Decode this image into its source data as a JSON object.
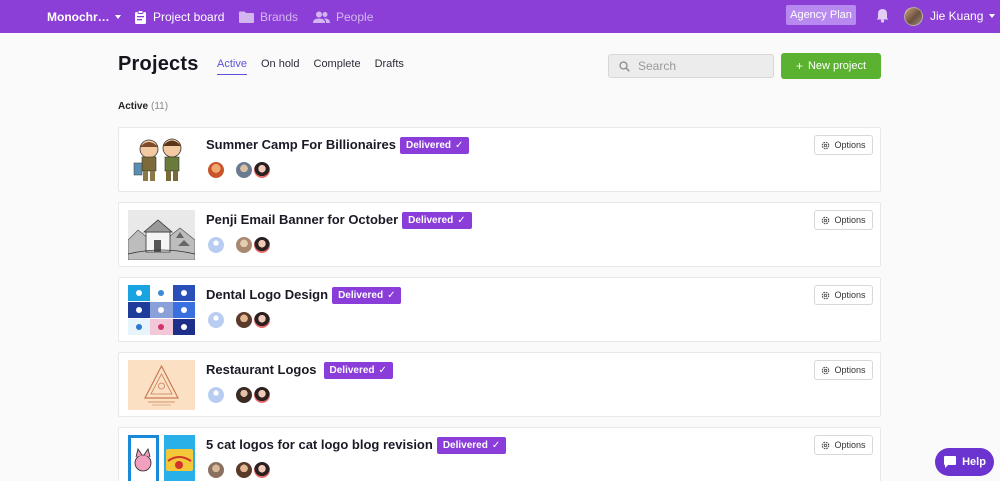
{
  "nav": {
    "brand": "Monochr…",
    "links": [
      {
        "label": "Project board",
        "icon": "clipboard-icon",
        "active": true
      },
      {
        "label": "Brands",
        "icon": "folder-icon",
        "active": false
      },
      {
        "label": "People",
        "icon": "people-icon",
        "active": false
      }
    ],
    "plan_badge": "Agency Plan",
    "user_name": "Jie Kuang"
  },
  "header": {
    "title": "Projects",
    "tabs": [
      {
        "label": "Active",
        "active": true
      },
      {
        "label": "On hold",
        "active": false
      },
      {
        "label": "Complete",
        "active": false
      },
      {
        "label": "Drafts",
        "active": false
      }
    ],
    "search_placeholder": "Search",
    "new_project_label": "New project"
  },
  "section": {
    "label": "Active",
    "count": "(11)"
  },
  "projects": [
    {
      "title": "Summer Camp For Billionaires",
      "status": "Delivered",
      "options_label": "Options"
    },
    {
      "title": "Penji Email Banner for October",
      "status": "Delivered",
      "options_label": "Options"
    },
    {
      "title": "Dental Logo Design",
      "status": "Delivered",
      "options_label": "Options"
    },
    {
      "title": "Restaurant Logos",
      "status": "Delivered",
      "options_label": "Options"
    },
    {
      "title": "5 cat logos for cat logo blog revision",
      "status": "Delivered",
      "options_label": "Options"
    }
  ],
  "help_label": "Help",
  "colors": {
    "nav_bg": "#8b3fd6",
    "badge": "#8a3dd8",
    "new_button": "#5bb230",
    "active_tab": "#5b54d6",
    "help": "#6b34d0"
  }
}
